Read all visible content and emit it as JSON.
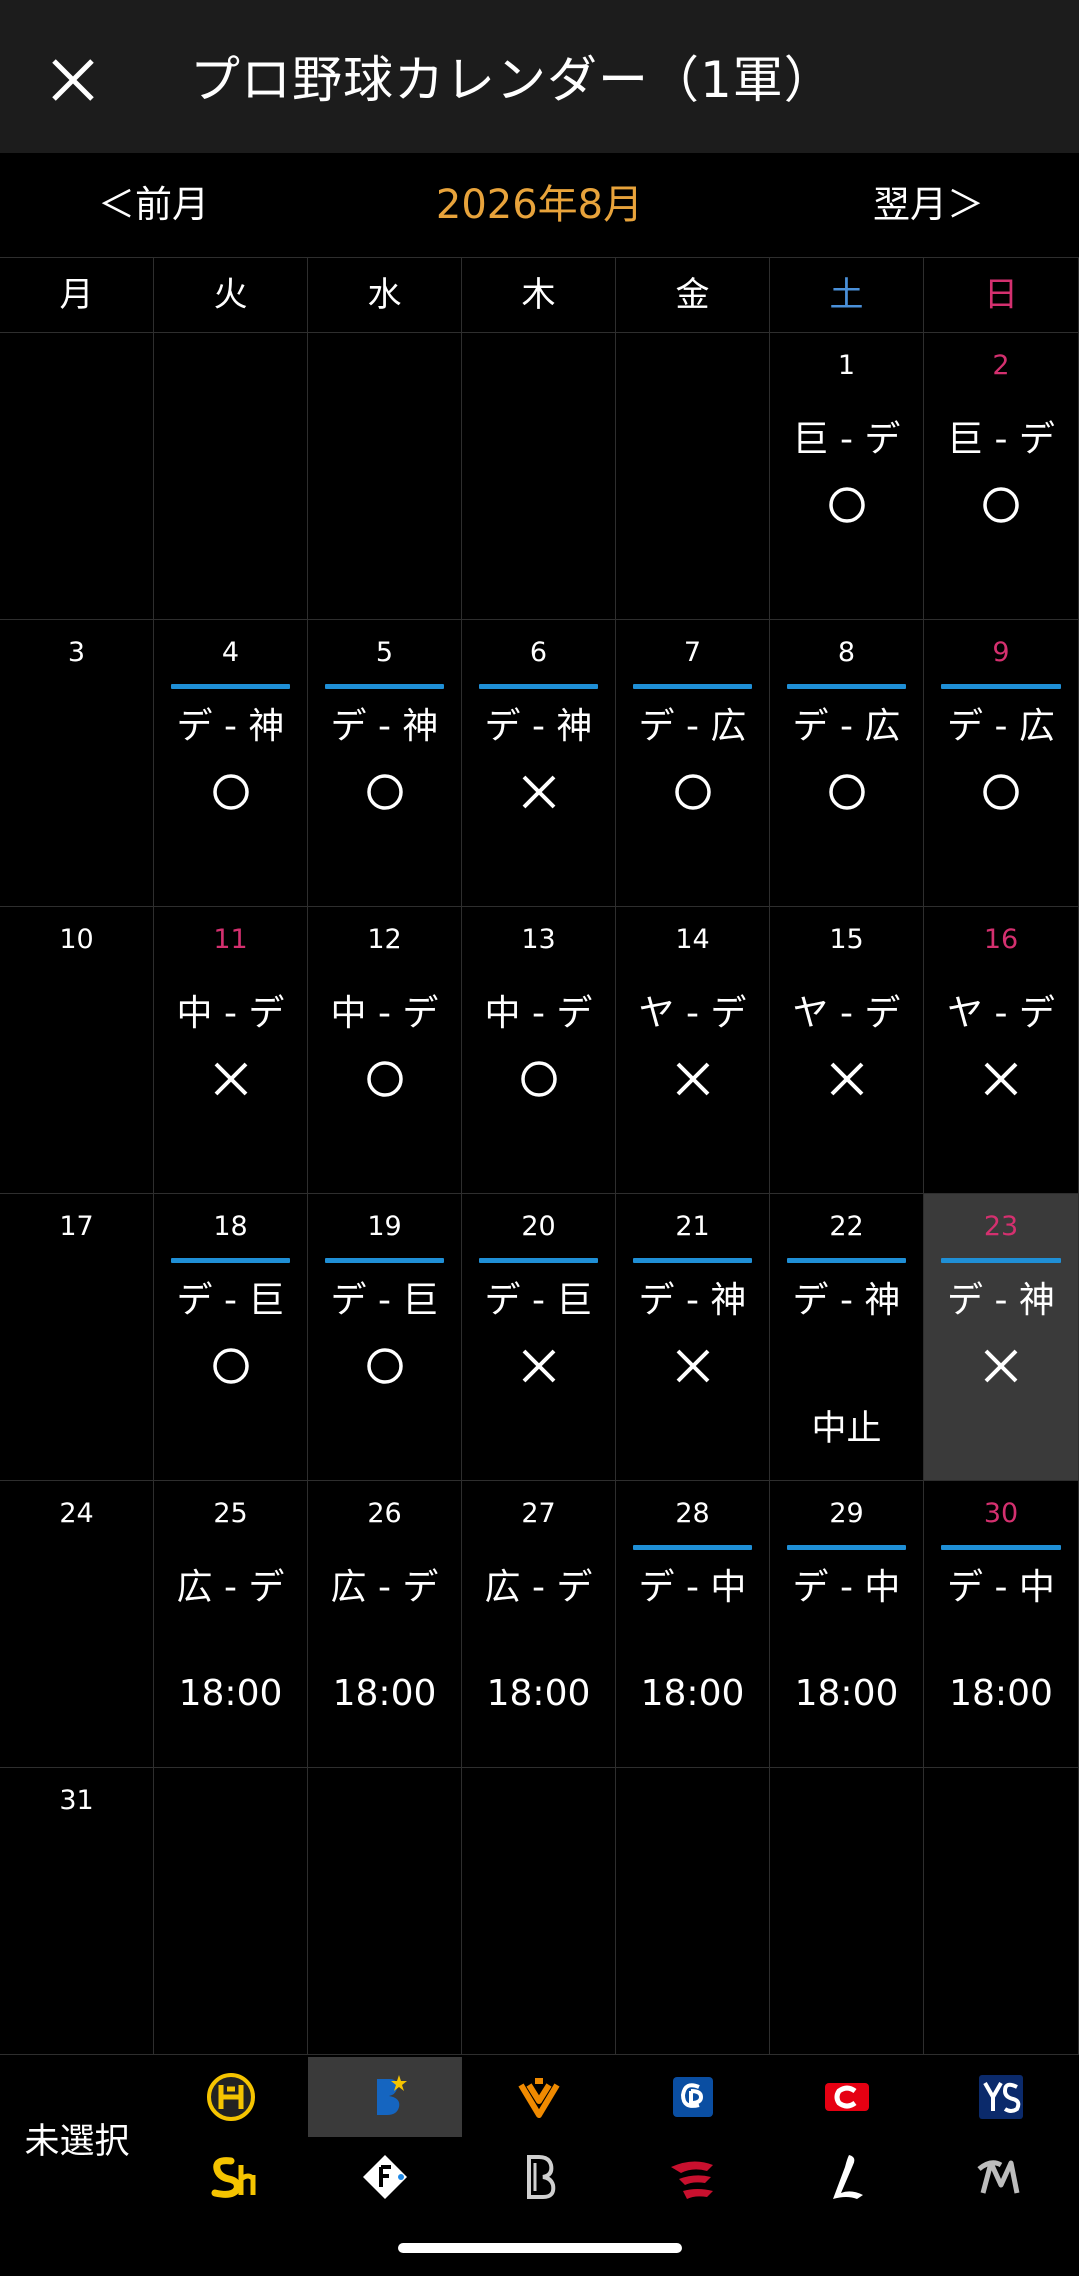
{
  "app": {
    "title": "プロ野球カレンダー（1軍）"
  },
  "month_nav": {
    "prev_label": "＜前月",
    "current": "2026年8月",
    "next_label": "翌月＞"
  },
  "colors": {
    "accent": "#e8a33b",
    "saturday": "#4a90d9",
    "sunday": "#d4306f",
    "highlight_bar": "#1f8fd6",
    "selected_bg": "#3a3a3a"
  },
  "weekdays": [
    {
      "label": "月",
      "type": "weekday"
    },
    {
      "label": "火",
      "type": "weekday"
    },
    {
      "label": "水",
      "type": "weekday"
    },
    {
      "label": "木",
      "type": "weekday"
    },
    {
      "label": "金",
      "type": "weekday"
    },
    {
      "label": "土",
      "type": "saturday"
    },
    {
      "label": "日",
      "type": "sunday"
    }
  ],
  "weeks": [
    [
      null,
      null,
      null,
      null,
      null,
      {
        "day": "1",
        "red": false,
        "bar": false,
        "matchup": "巨 - デ",
        "result": "circle"
      },
      {
        "day": "2",
        "red": true,
        "bar": false,
        "matchup": "巨 - デ",
        "result": "circle"
      }
    ],
    [
      {
        "day": "3",
        "red": false,
        "bar": false
      },
      {
        "day": "4",
        "red": false,
        "bar": true,
        "matchup": "デ - 神",
        "result": "circle"
      },
      {
        "day": "5",
        "red": false,
        "bar": true,
        "matchup": "デ - 神",
        "result": "circle"
      },
      {
        "day": "6",
        "red": false,
        "bar": true,
        "matchup": "デ - 神",
        "result": "cross"
      },
      {
        "day": "7",
        "red": false,
        "bar": true,
        "matchup": "デ - 広",
        "result": "circle"
      },
      {
        "day": "8",
        "red": false,
        "bar": true,
        "matchup": "デ - 広",
        "result": "circle"
      },
      {
        "day": "9",
        "red": true,
        "bar": true,
        "matchup": "デ - 広",
        "result": "circle"
      }
    ],
    [
      {
        "day": "10",
        "red": false,
        "bar": false
      },
      {
        "day": "11",
        "red": true,
        "bar": false,
        "matchup": "中 - デ",
        "result": "cross"
      },
      {
        "day": "12",
        "red": false,
        "bar": false,
        "matchup": "中 - デ",
        "result": "circle"
      },
      {
        "day": "13",
        "red": false,
        "bar": false,
        "matchup": "中 - デ",
        "result": "circle"
      },
      {
        "day": "14",
        "red": false,
        "bar": false,
        "matchup": "ヤ - デ",
        "result": "cross"
      },
      {
        "day": "15",
        "red": false,
        "bar": false,
        "matchup": "ヤ - デ",
        "result": "cross"
      },
      {
        "day": "16",
        "red": true,
        "bar": false,
        "matchup": "ヤ - デ",
        "result": "cross"
      }
    ],
    [
      {
        "day": "17",
        "red": false,
        "bar": false
      },
      {
        "day": "18",
        "red": false,
        "bar": true,
        "matchup": "デ - 巨",
        "result": "circle"
      },
      {
        "day": "19",
        "red": false,
        "bar": true,
        "matchup": "デ - 巨",
        "result": "circle"
      },
      {
        "day": "20",
        "red": false,
        "bar": true,
        "matchup": "デ - 巨",
        "result": "cross"
      },
      {
        "day": "21",
        "red": false,
        "bar": true,
        "matchup": "デ - 神",
        "result": "cross"
      },
      {
        "day": "22",
        "red": false,
        "bar": true,
        "matchup": "デ - 神",
        "result": "none",
        "note": "中止"
      },
      {
        "day": "23",
        "red": true,
        "bar": true,
        "matchup": "デ - 神",
        "result": "cross",
        "selected": true
      }
    ],
    [
      {
        "day": "24",
        "red": false,
        "bar": false
      },
      {
        "day": "25",
        "red": false,
        "bar": false,
        "matchup": "広 - デ",
        "time": "18:00"
      },
      {
        "day": "26",
        "red": false,
        "bar": false,
        "matchup": "広 - デ",
        "time": "18:00"
      },
      {
        "day": "27",
        "red": false,
        "bar": false,
        "matchup": "広 - デ",
        "time": "18:00"
      },
      {
        "day": "28",
        "red": false,
        "bar": true,
        "matchup": "デ - 中",
        "time": "18:00"
      },
      {
        "day": "29",
        "red": false,
        "bar": true,
        "matchup": "デ - 中",
        "time": "18:00"
      },
      {
        "day": "30",
        "red": true,
        "bar": true,
        "matchup": "デ - 中",
        "time": "18:00"
      }
    ],
    [
      {
        "day": "31",
        "red": false,
        "bar": false
      },
      null,
      null,
      null,
      null,
      null,
      null
    ]
  ],
  "team_bar": {
    "unselected_label": "未選択",
    "teams_row1": [
      {
        "icon": "tigers-logo-icon",
        "color": "#f5c400",
        "selected": false
      },
      {
        "icon": "baystars-logo-icon",
        "color": "#1565c0",
        "selected": true
      },
      {
        "icon": "giants-logo-icon",
        "color": "#f08a00",
        "selected": false
      },
      {
        "icon": "dragons-logo-icon",
        "color": "#0a4ea2",
        "selected": false
      },
      {
        "icon": "carp-logo-icon",
        "color": "#e60012",
        "selected": false
      },
      {
        "icon": "swallows-logo-icon",
        "color": "#0b2a6b",
        "selected": false
      }
    ],
    "teams_row2": [
      {
        "icon": "hawks-logo-icon",
        "color": "#f5c400",
        "selected": false
      },
      {
        "icon": "fighters-logo-icon",
        "color": "#ffffff",
        "selected": false
      },
      {
        "icon": "buffaloes-logo-icon",
        "color": "#d0d0d0",
        "selected": false
      },
      {
        "icon": "eagles-logo-icon",
        "color": "#c8102e",
        "selected": false
      },
      {
        "icon": "lions-logo-icon",
        "color": "#ffffff",
        "selected": false
      },
      {
        "icon": "marines-logo-icon",
        "color": "#bdbdbd",
        "selected": false
      }
    ]
  }
}
